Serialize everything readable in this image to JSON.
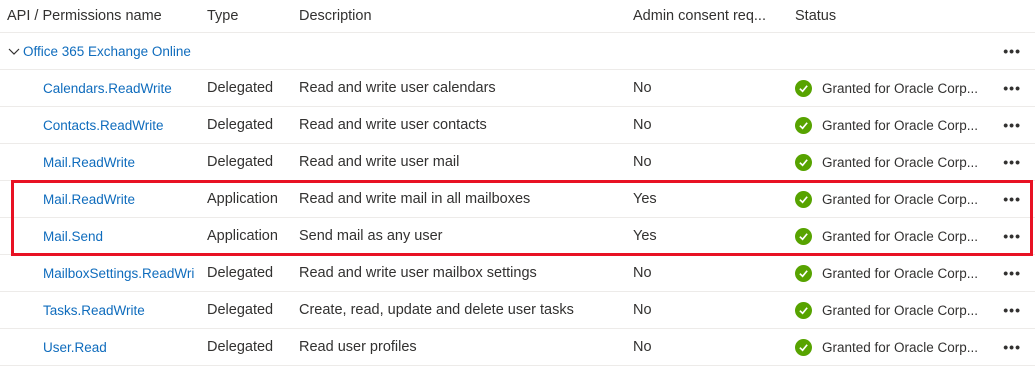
{
  "columns": {
    "name": "API / Permissions name",
    "type": "Type",
    "description": "Description",
    "admin": "Admin consent req...",
    "status": "Status"
  },
  "group": {
    "label": "Office 365 Exchange Online",
    "more": "•••"
  },
  "rows": [
    {
      "name": "Calendars.ReadWrite",
      "type": "Delegated",
      "description": "Read and write user calendars",
      "admin": "No",
      "status": "Granted for Oracle Corp...",
      "more": "•••"
    },
    {
      "name": "Contacts.ReadWrite",
      "type": "Delegated",
      "description": "Read and write user contacts",
      "admin": "No",
      "status": "Granted for Oracle Corp...",
      "more": "•••"
    },
    {
      "name": "Mail.ReadWrite",
      "type": "Delegated",
      "description": "Read and write user mail",
      "admin": "No",
      "status": "Granted for Oracle Corp...",
      "more": "•••"
    },
    {
      "name": "Mail.ReadWrite",
      "type": "Application",
      "description": "Read and write mail in all mailboxes",
      "admin": "Yes",
      "status": "Granted for Oracle Corp...",
      "more": "•••"
    },
    {
      "name": "Mail.Send",
      "type": "Application",
      "description": "Send mail as any user",
      "admin": "Yes",
      "status": "Granted for Oracle Corp...",
      "more": "•••"
    },
    {
      "name": "MailboxSettings.ReadWri",
      "type": "Delegated",
      "description": "Read and write user mailbox settings",
      "admin": "No",
      "status": "Granted for Oracle Corp...",
      "more": "•••"
    },
    {
      "name": "Tasks.ReadWrite",
      "type": "Delegated",
      "description": "Create, read, update and delete user tasks",
      "admin": "No",
      "status": "Granted for Oracle Corp...",
      "more": "•••"
    },
    {
      "name": "User.Read",
      "type": "Delegated",
      "description": "Read user profiles",
      "admin": "No",
      "status": "Granted for Oracle Corp...",
      "more": "•••"
    }
  ],
  "colors": {
    "link": "#0f6cbd",
    "granted": "#57a300",
    "highlight": "#e81123"
  }
}
